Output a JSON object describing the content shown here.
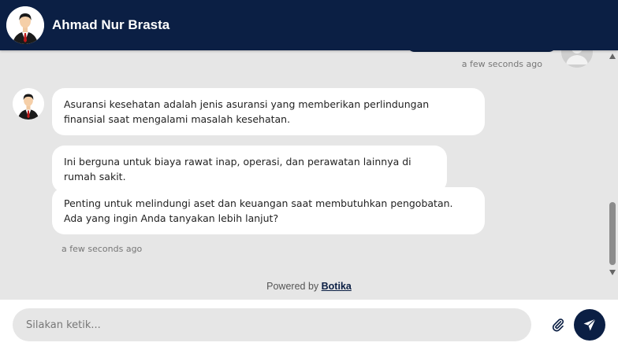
{
  "header": {
    "name": "Ahmad Nur Brasta",
    "avatar_icon": "agent-avatar-icon"
  },
  "chat": {
    "user_timestamp": "a few seconds ago",
    "bot_messages": [
      "Asuransi kesehatan adalah jenis asuransi yang memberikan perlindungan finansial saat mengalami masalah kesehatan.",
      "Ini berguna untuk biaya rawat inap, operasi, dan perawatan lainnya di rumah sakit.",
      "Penting untuk melindungi aset dan keuangan saat membutuhkan pengobatan. Ada yang ingin Anda tanyakan lebih lanjut?"
    ],
    "bot_timestamp": "a few seconds ago"
  },
  "footer": {
    "powered_prefix": "Powered by",
    "powered_brand": "Botika",
    "input_placeholder": "Silakan ketik...",
    "input_value": "",
    "attach_icon": "paperclip-icon",
    "send_icon": "paper-plane-icon"
  },
  "colors": {
    "primary": "#0b1f44",
    "background": "#e6e6e6",
    "bubble": "#ffffff"
  }
}
